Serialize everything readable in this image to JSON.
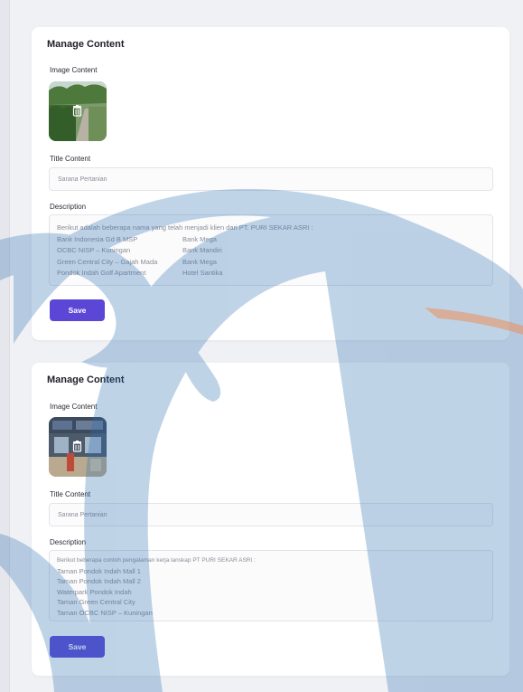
{
  "cards": [
    {
      "title": "Manage Content",
      "image_label": "Image Content",
      "title_label": "Title Content",
      "title_value": "Sarana Pertanian",
      "description_label": "Description",
      "description_intro": "Berikut adalah beberapa nama yang telah menjadi klien dari PT. PURI SEKAR ASRI :",
      "description_rows": [
        [
          "Bank Indonesia Gd B MSP",
          "Bank Mega"
        ],
        [
          "OCBC NISP – Kuningan",
          "Bank Mandiri"
        ],
        [
          "Green Central City – Gajah Mada",
          "Bank Mega"
        ],
        [
          "Pondok Indah Golf Apartment",
          "Hotel Santika"
        ]
      ],
      "save_label": "Save"
    },
    {
      "title": "Manage Content",
      "image_label": "Image Content",
      "title_label": "Title Content",
      "title_value": "Sarana Pertanian",
      "description_label": "Description",
      "description_intro": "Berikut beberapa contoh pengalaman kerja lanskap PT PURI SEKAR ASRI :",
      "description_lines": [
        "Taman Pondok Indah Mall 1",
        "Taman Pondok Indah Mall 2",
        "Waterpark Pondok Indah",
        "Taman Green Central City",
        "Taman OCBC NISP – Kuningan"
      ],
      "save_label": "Save"
    }
  ],
  "colors": {
    "page_bg": "#f0f1f5",
    "card_bg": "#ffffff",
    "save_button": "#5b47d6",
    "watermark_blue": "#2f6fb3",
    "watermark_orange": "#f08a4b"
  },
  "icons": {
    "thumbnail_overlay": "trash-icon"
  }
}
